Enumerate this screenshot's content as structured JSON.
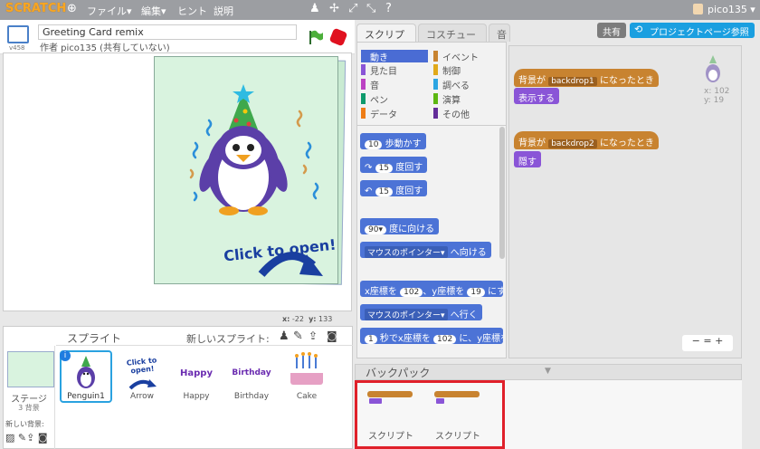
{
  "topbar": {
    "logo": "SCRATCH",
    "menus": [
      "ファイル▾",
      "編集▾",
      "ヒント",
      "説明"
    ],
    "user": "pico135 ▾"
  },
  "stage": {
    "version": "v458",
    "project_title": "Greeting Card remix",
    "author": "作者 pico135 (共有していない)",
    "coords_x_label": "x:",
    "coords_x": "-22",
    "coords_y_label": "y:",
    "coords_y": "133",
    "card_text": "Click to open!"
  },
  "sprites": {
    "header": "スプライト",
    "new_sprite": "新しいスプライト:",
    "stage_label": "ステージ",
    "stage_sub": "3 背景",
    "new_backdrop": "新しい背景:",
    "items": [
      {
        "label": "Penguin1",
        "image_text": ""
      },
      {
        "label": "Arrow",
        "image_text": "Click to open!"
      },
      {
        "label": "Happy",
        "image_text": "Happy"
      },
      {
        "label": "Birthday",
        "image_text": "Birthday"
      },
      {
        "label": "Cake",
        "image_text": ""
      }
    ]
  },
  "tabs": [
    "スクリプト",
    "コスチューム",
    "音"
  ],
  "share": {
    "share_label": "共有",
    "project_page_label": "プロジェクトページ参照"
  },
  "categories": [
    {
      "label": "動き",
      "color": "#4a6cd4"
    },
    {
      "label": "イベント",
      "color": "#c88330"
    },
    {
      "label": "見た目",
      "color": "#8a55d7"
    },
    {
      "label": "制御",
      "color": "#e1a91a"
    },
    {
      "label": "音",
      "color": "#bb42c3"
    },
    {
      "label": "調べる",
      "color": "#2ca5e2"
    },
    {
      "label": "ペン",
      "color": "#0e9a6c"
    },
    {
      "label": "演算",
      "color": "#5cb712"
    },
    {
      "label": "データ",
      "color": "#ee7d16"
    },
    {
      "label": "その他",
      "color": "#632d99"
    }
  ],
  "blocks": {
    "move_val": "10",
    "move": "歩動かす",
    "turn_r_val": "15",
    "turn_r": "度回す",
    "turn_l_val": "15",
    "turn_l": "度回す",
    "point_val": "90▾",
    "point": "度に向ける",
    "point_towards_dd": "マウスのポインター▾",
    "point_towards": "へ向ける",
    "goto_xy_x_pre": "x座標を",
    "goto_xy_x": "102",
    "goto_xy_y_pre": "、y座標を",
    "goto_xy_y": "19",
    "goto_xy_suf": "にする",
    "goto_dd": "マウスのポインター▾",
    "goto": "へ行く",
    "glide_val": "1",
    "glide_mid": "秒でx座標を",
    "glide_x": "102",
    "glide_y_pre": "に、y座標を"
  },
  "workspace": {
    "sprite_x_label": "x:",
    "sprite_x": "102",
    "sprite_y_label": "y:",
    "sprite_y": "19",
    "script1_hat_pre": "背景が",
    "script1_dd": "backdrop1",
    "script1_hat_suf": "になったとき",
    "script1_action": "表示する",
    "script2_hat_pre": "背景が",
    "script2_dd": "backdrop2",
    "script2_hat_suf": "になったとき",
    "script2_action": "隠す",
    "zoom": "− = +"
  },
  "backpack": {
    "header": "バックパック",
    "items": [
      "スクリプト",
      "スクリプト"
    ]
  }
}
